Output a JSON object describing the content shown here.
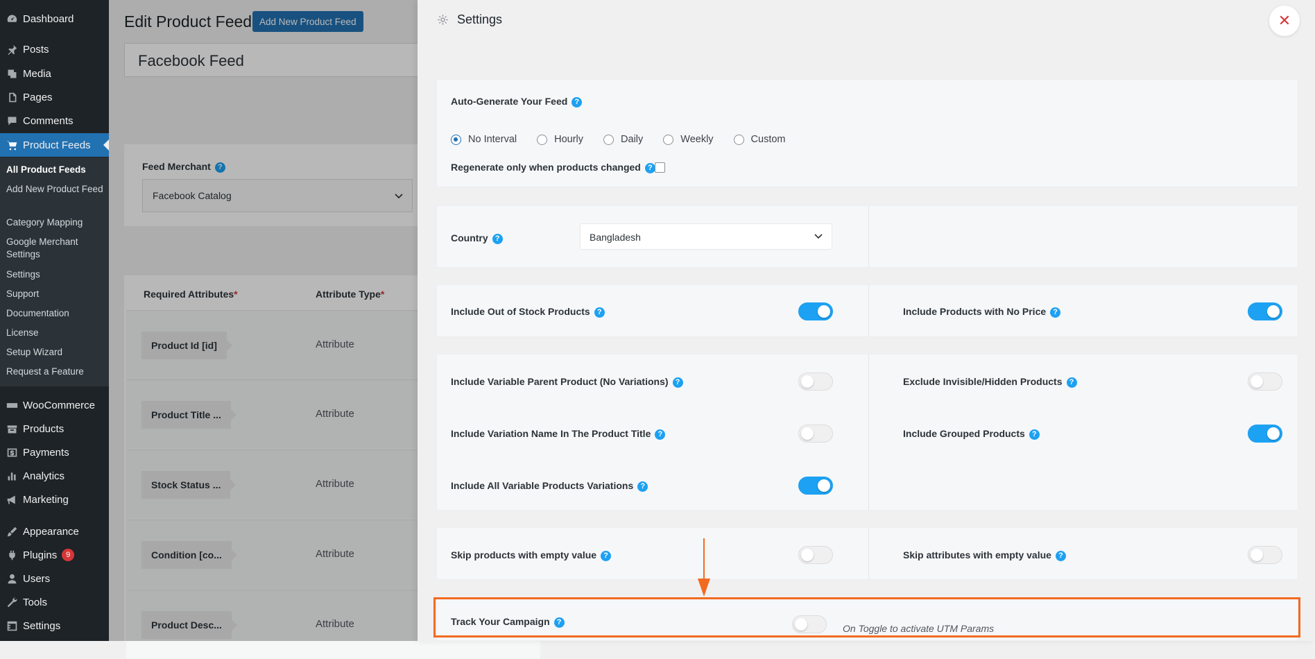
{
  "sidebar": {
    "items": [
      {
        "label": "Dashboard",
        "icon": "dashboard-icon"
      },
      {
        "label": "Posts",
        "icon": "pin-icon"
      },
      {
        "label": "Media",
        "icon": "media-icon"
      },
      {
        "label": "Pages",
        "icon": "pages-icon"
      },
      {
        "label": "Comments",
        "icon": "comment-icon"
      },
      {
        "label": "Product Feeds",
        "icon": "cart-icon"
      },
      {
        "label": "WooCommerce",
        "icon": "woo-icon"
      },
      {
        "label": "Products",
        "icon": "archive-icon"
      },
      {
        "label": "Payments",
        "icon": "dollar-icon"
      },
      {
        "label": "Analytics",
        "icon": "bar-chart-icon"
      },
      {
        "label": "Marketing",
        "icon": "megaphone-icon"
      },
      {
        "label": "Appearance",
        "icon": "brush-icon"
      },
      {
        "label": "Plugins",
        "icon": "plug-icon",
        "badge": "9"
      },
      {
        "label": "Users",
        "icon": "user-icon"
      },
      {
        "label": "Tools",
        "icon": "wrench-icon"
      },
      {
        "label": "Settings",
        "icon": "settings-icon"
      }
    ],
    "submenu": [
      "All Product Feeds",
      "Add New Product Feed",
      "Category Mapping",
      "Google Merchant Settings",
      "Settings",
      "Support",
      "Documentation",
      "License",
      "Setup Wizard",
      "Request a Feature"
    ]
  },
  "main": {
    "title": "Edit Product Feed",
    "add_new_label": "Add New Product Feed",
    "feed_name": "Facebook Feed",
    "merchant_label": "Feed Merchant",
    "merchant_value": "Facebook Catalog",
    "table": {
      "col_required": "Required Attributes",
      "col_type": "Attribute Type",
      "asterisk": "*",
      "rows": [
        {
          "attr": "Product Id [id]",
          "type": "Attribute"
        },
        {
          "attr": "Product Title ...",
          "type": "Attribute"
        },
        {
          "attr": "Stock Status ...",
          "type": "Attribute"
        },
        {
          "attr": "Condition [co...",
          "type": "Attribute"
        },
        {
          "attr": "Product Desc...",
          "type": "Attribute"
        }
      ]
    }
  },
  "panel": {
    "title": "Settings",
    "close": "✕",
    "help": "?",
    "auto_generate_label": "Auto-Generate Your Feed",
    "intervals": [
      "No Interval",
      "Hourly",
      "Daily",
      "Weekly",
      "Custom"
    ],
    "selected_interval": "No Interval",
    "regenerate_label": "Regenerate only when products changed",
    "regenerate_checked": false,
    "country_label": "Country",
    "country_value": "Bangladesh",
    "out_of_stock_label": "Include Out of Stock Products",
    "out_of_stock_on": true,
    "no_price_label": "Include Products with No Price",
    "no_price_on": true,
    "variable_parent_label": "Include Variable Parent Product (No Variations)",
    "variable_parent_on": false,
    "exclude_hidden_label": "Exclude Invisible/Hidden Products",
    "exclude_hidden_on": false,
    "variation_name_label": "Include Variation Name In The Product Title",
    "variation_name_on": false,
    "grouped_label": "Include Grouped Products",
    "grouped_on": true,
    "all_variations_label": "Include All Variable Products Variations",
    "all_variations_on": true,
    "skip_products_label": "Skip products with empty value",
    "skip_products_on": false,
    "skip_attributes_label": "Skip attributes with empty value",
    "skip_attributes_on": false,
    "track_campaign_label": "Track Your Campaign",
    "track_campaign_on": false,
    "utm_hint": "On Toggle to activate UTM Params"
  },
  "colors": {
    "accent": "#2271b1",
    "toggle_on": "#1da1f2",
    "highlight": "#f26a21",
    "close": "#d63638"
  }
}
